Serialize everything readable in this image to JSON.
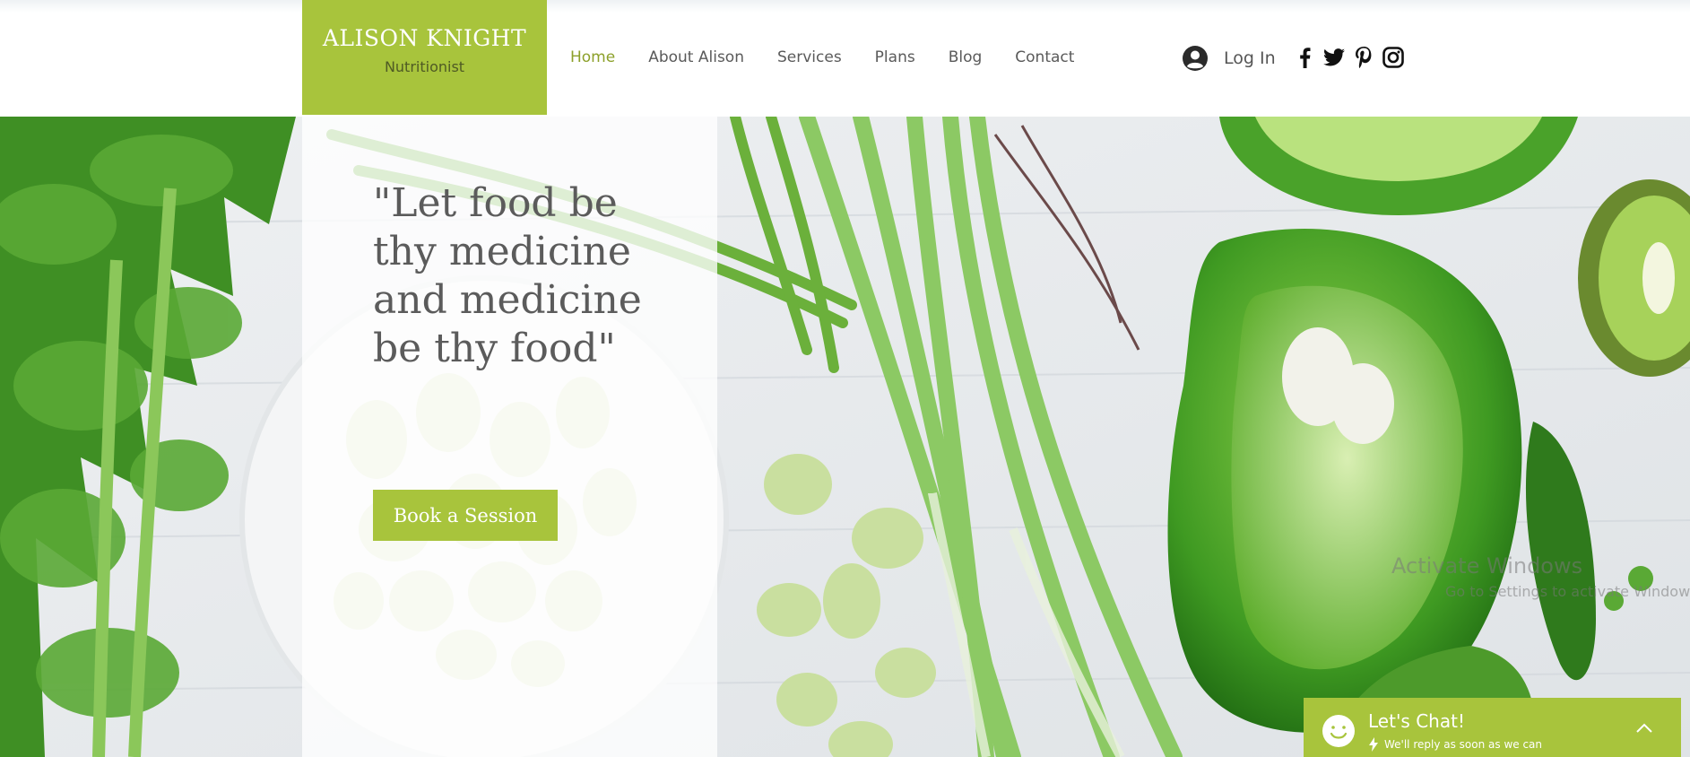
{
  "brand": {
    "name": "ALISON KNIGHT",
    "tagline": "Nutritionist",
    "accent_color": "#a8c43c"
  },
  "nav": {
    "items": [
      {
        "label": "Home",
        "active": true
      },
      {
        "label": "About Alison",
        "active": false
      },
      {
        "label": "Services",
        "active": false
      },
      {
        "label": "Plans",
        "active": false
      },
      {
        "label": "Blog",
        "active": false
      },
      {
        "label": "Contact",
        "active": false
      }
    ],
    "active_color": "#8ca02a"
  },
  "login": {
    "label": "Log In",
    "icon": "user-avatar-icon"
  },
  "socials": [
    {
      "icon": "facebook-icon"
    },
    {
      "icon": "twitter-icon"
    },
    {
      "icon": "pinterest-icon"
    },
    {
      "icon": "instagram-icon"
    }
  ],
  "hero": {
    "quote": "\"Let food be thy medicine and medicine be thy food\"",
    "cta_label": "Book a Session"
  },
  "os_watermark": {
    "title": "Activate Windows",
    "subtitle": "Go to Settings to activate Windows."
  },
  "chat": {
    "title": "Let's Chat!",
    "subtitle": "We'll reply as soon as we can",
    "icons": [
      "smiley-icon",
      "lightning-icon",
      "chevron-up-icon"
    ]
  }
}
